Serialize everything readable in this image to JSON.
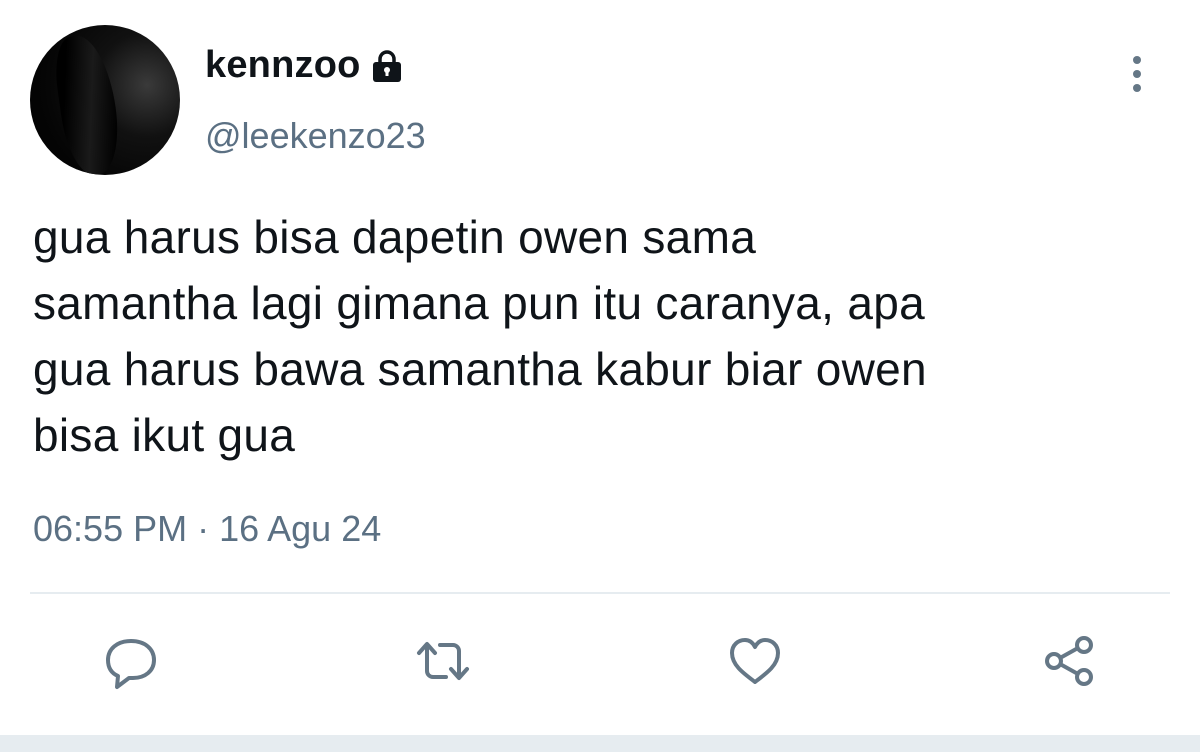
{
  "user": {
    "display_name": "kennzoo",
    "handle": "@leekenzo23",
    "avatar_icon": "profile-photo"
  },
  "tweet": {
    "text": "gua harus bisa dapetin owen sama\nsamantha lagi gimana pun itu caranya, apa\ngua harus bawa samantha kabur biar owen\nbisa ikut gua",
    "time": "06:55 PM",
    "separator": "·",
    "date": "16 Agu 24"
  },
  "icons": {
    "lock": "lock-icon",
    "more": "more-vertical-icon",
    "reply": "reply-icon",
    "retweet": "retweet-icon",
    "like": "heart-icon",
    "share": "share-icon"
  },
  "colors": {
    "text_primary": "#0f1419",
    "text_secondary": "#5b7083",
    "icon": "#657786",
    "divider": "#e6ecf0"
  }
}
